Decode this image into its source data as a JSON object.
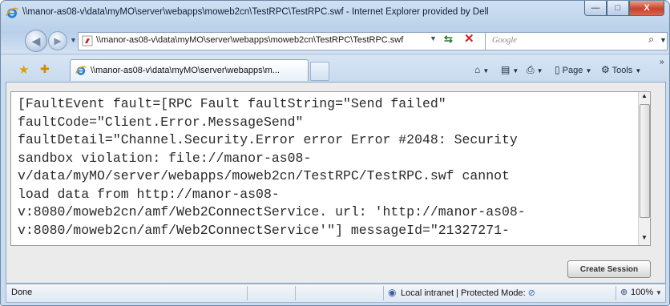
{
  "window": {
    "title": "\\\\manor-as08-v\\data\\myMO\\server\\webapps\\moweb2cn\\TestRPC\\TestRPC.swf - Internet Explorer provided by Dell",
    "minimize_glyph": "—",
    "maximize_glyph": "□",
    "close_glyph": "X"
  },
  "nav": {
    "back_glyph": "◀",
    "forward_glyph": "▶",
    "dropdown_glyph": "▼",
    "address": "\\\\manor-as08-v\\data\\myMO\\server\\webapps\\moweb2cn\\TestRPC\\TestRPC.swf",
    "address_dropdown_glyph": "▼",
    "refresh_glyph": "⇆",
    "stop_glyph": "✕",
    "search_placeholder": "Google",
    "search_glyph": "⌕",
    "search_dropdown_glyph": "▼"
  },
  "tabs": {
    "favorites_glyph": "★",
    "add_favorites_glyph": "✚",
    "active_tab_label": "\\\\manor-as08-v\\data\\myMO\\server\\webapps\\m...",
    "commands": {
      "home_glyph": "⌂",
      "feeds_glyph": "▤",
      "print_glyph": "⎙",
      "page_label": "Page",
      "tools_label": "Tools",
      "dropdown_glyph": "▼",
      "more_glyph": "»"
    }
  },
  "content": {
    "message": "[FaultEvent fault=[RPC Fault faultString=\"Send failed\"\nfaultCode=\"Client.Error.MessageSend\"\nfaultDetail=\"Channel.Security.Error error Error #2048: Security\nsandbox violation: file://manor-as08-\nv/data/myMO/server/webapps/moweb2cn/TestRPC/TestRPC.swf cannot\nload data from http://manor-as08-\nv:8080/moweb2cn/amf/Web2ConnectService. url: 'http://manor-as08-\nv:8080/moweb2cn/amf/Web2ConnectService'\"] messageId=\"21327271-",
    "scroll_up_glyph": "▲",
    "scroll_down_glyph": "▼",
    "create_session_label": "Create Session"
  },
  "status": {
    "text": "Done",
    "zone_glyph": "◉",
    "zone_text": "Local intranet | Protected Mode: ",
    "zoom_glyph": "⊕",
    "zoom": "100%",
    "zoom_dropdown_glyph": "▼"
  },
  "colors": {
    "frame": "#b9d0ea",
    "close_button": "#c7432a",
    "stop_icon": "#cc2222",
    "favorites_star": "#e0a100"
  }
}
